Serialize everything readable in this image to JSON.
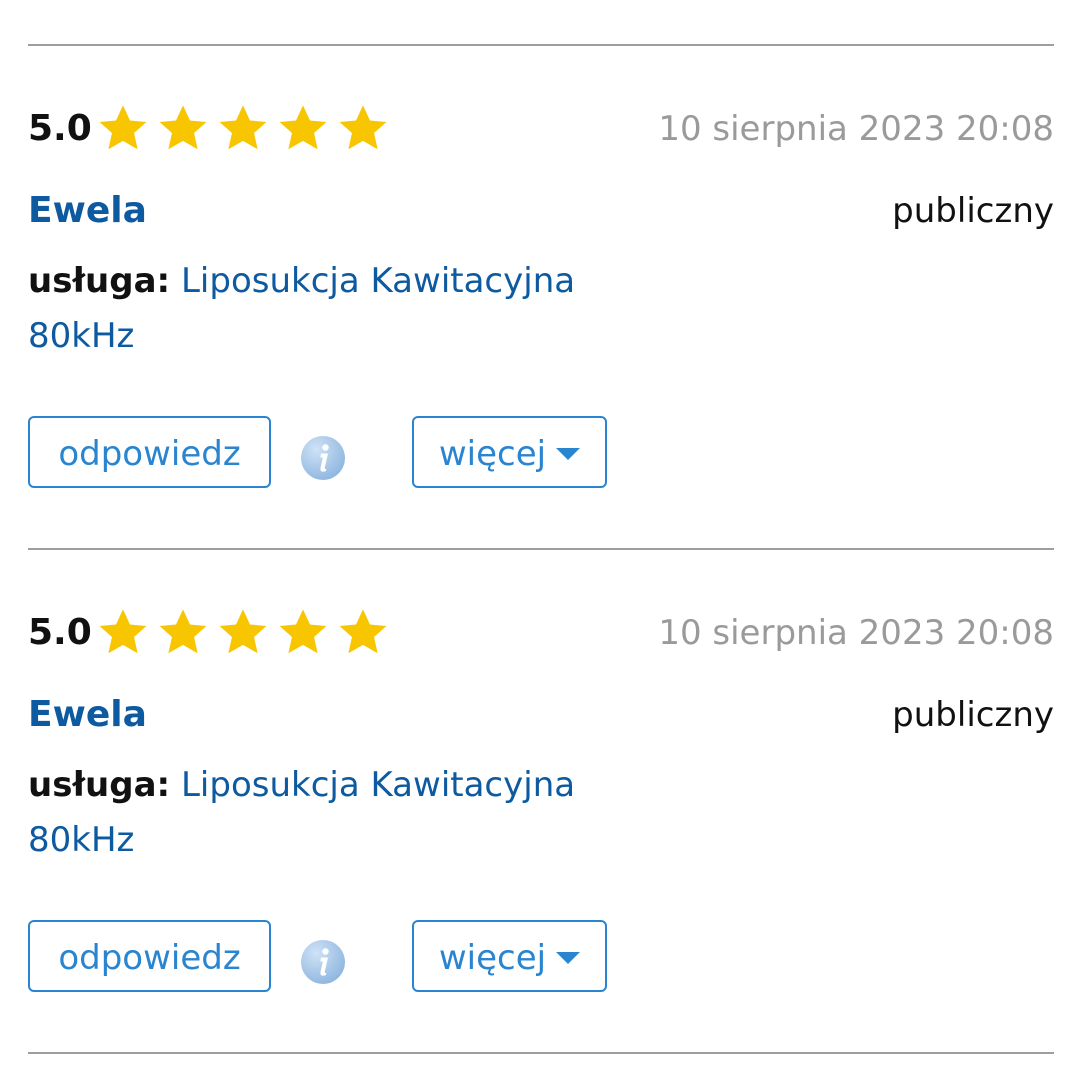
{
  "colors": {
    "star": "#f7c600",
    "link": "#0d5aa0",
    "button": "#2a85d0",
    "date": "#9a9a9a",
    "divider": "#9e9e9e"
  },
  "reviews": [
    {
      "score": "5.0",
      "stars": 5,
      "date": "10 sierpnia 2023 20:08",
      "author": "Ewela",
      "visibility": "publiczny",
      "service_label": "usługa:",
      "service_name": "Liposukcja Kawitacyjna 80kHz",
      "reply_label": "odpowiedz",
      "info_icon": "info-icon",
      "more_label": "więcej",
      "more_icon": "caret-down-icon"
    },
    {
      "score": "5.0",
      "stars": 5,
      "date": "10 sierpnia 2023 20:08",
      "author": "Ewela",
      "visibility": "publiczny",
      "service_label": "usługa:",
      "service_name": "Liposukcja Kawitacyjna 80kHz",
      "reply_label": "odpowiedz",
      "info_icon": "info-icon",
      "more_label": "więcej",
      "more_icon": "caret-down-icon"
    }
  ]
}
